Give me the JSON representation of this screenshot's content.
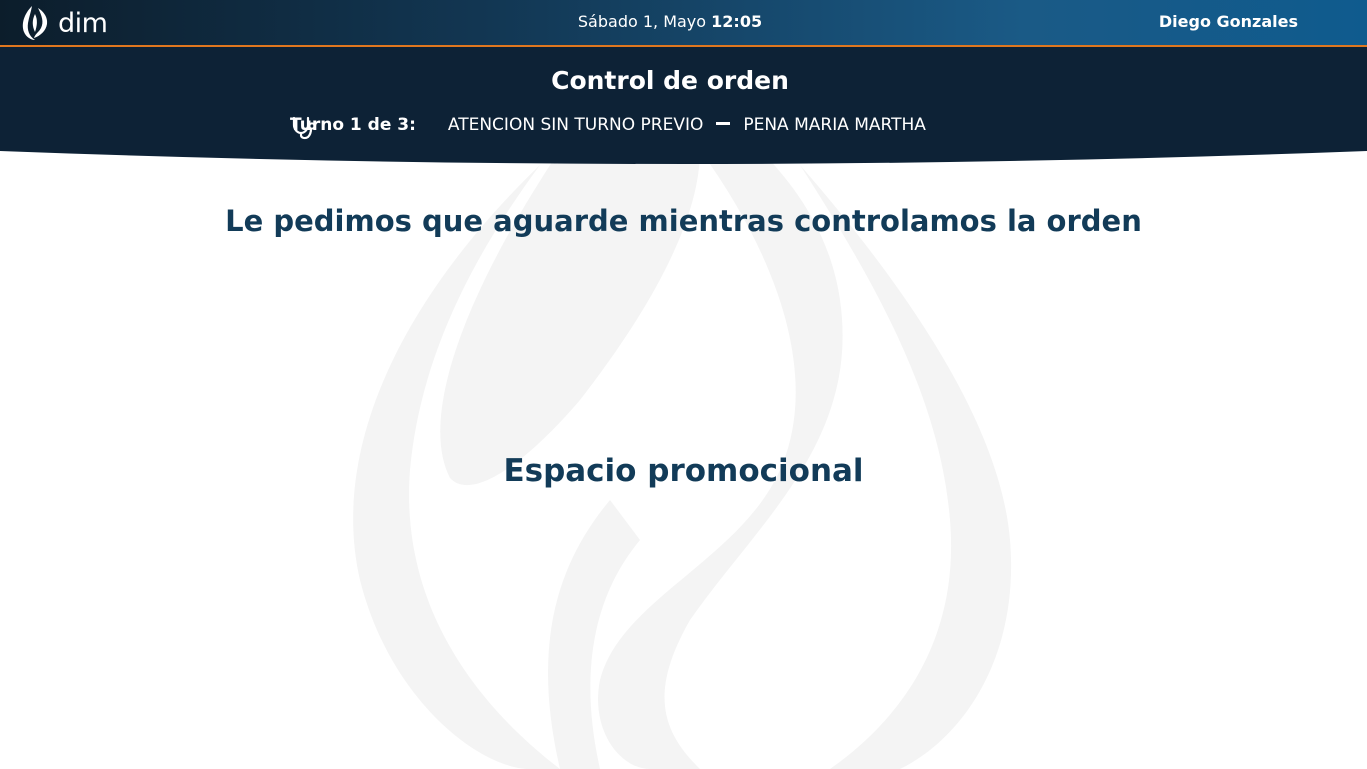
{
  "topbar": {
    "logo_text": "dim",
    "date": "Sábado 1, Mayo",
    "time": "12:05",
    "user_name": "Diego Gonzales"
  },
  "header": {
    "title": "Control de orden",
    "turno_label": "Turno 1 de 3:",
    "turno_type": "ATENCION SIN TURNO PREVIO",
    "patient_name": "PENA MARIA MARTHA",
    "icon": "stethoscope-icon"
  },
  "main": {
    "message": "Le pedimos que aguarde mientras controlamos la orden",
    "promo": "Espacio promocional"
  },
  "colors": {
    "header_dark": "#0d2236",
    "accent_orange": "#e0771f",
    "text_dark_blue": "#123b58",
    "watermark": "#f4f4f4"
  }
}
